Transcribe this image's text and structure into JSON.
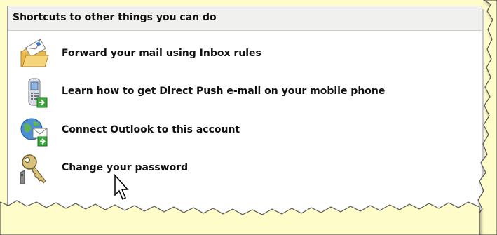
{
  "panel": {
    "title": "Shortcuts to other things you can do"
  },
  "shortcuts": [
    {
      "label": "Forward your mail using Inbox rules",
      "icon": "folder-mail-icon"
    },
    {
      "label": "Learn how to get Direct Push e-mail on your mobile phone",
      "icon": "mobile-phone-icon"
    },
    {
      "label": "Connect Outlook to this account",
      "icon": "globe-mail-icon"
    },
    {
      "label": "Change your password",
      "icon": "key-icon"
    }
  ],
  "colors": {
    "background": "#fefcc8",
    "panel": "#ffffff",
    "header": "#f0f0ef"
  }
}
